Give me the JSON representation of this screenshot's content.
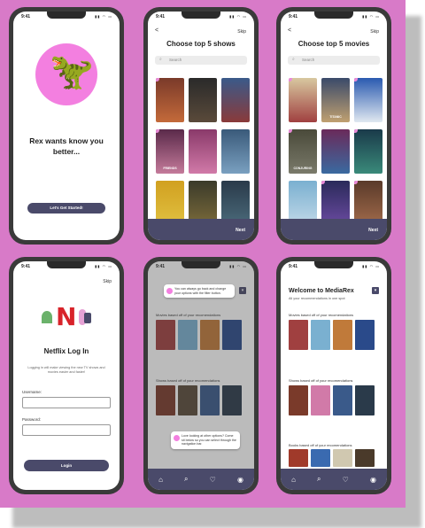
{
  "status": {
    "time": "9:41",
    "icons": "▮▮ ◠ ▭"
  },
  "common": {
    "skip": "Skip",
    "back": "<",
    "next": "Next"
  },
  "welcome": {
    "headline": "Rex wants know you better...",
    "cta": "Let's Get Started!"
  },
  "shows": {
    "title": "Choose top 5 shows",
    "search_placeholder": "Search",
    "posters": [
      "",
      "",
      "",
      "FRIENDS",
      "",
      "",
      "",
      "",
      ""
    ]
  },
  "movies": {
    "title": "Choose top 5 movies",
    "search_placeholder": "Search",
    "posters": [
      "",
      "TITANIC",
      "",
      "CONJURING",
      "",
      "",
      "",
      "",
      ""
    ]
  },
  "netflix": {
    "logo_letter": "N",
    "title": "Netflix Log In",
    "subtitle": "Logging in will make viewing the new TV shows and movies easier and faster!",
    "username_label": "Username:",
    "password_label": "Password:",
    "login_button": "Login"
  },
  "onboarding": {
    "tip_filter": "You can always go back and change your options with the filter button.",
    "tip_nav": "Love looking at other options? Come sit below so you can select through the navigation bar."
  },
  "home": {
    "title": "Welcome to MediaRex",
    "subtitle": "All your recommendations in one spot",
    "section_movies": "Movies based off of your recomendations",
    "section_shows": "Shows based off of your recomendations",
    "section_books": "Books based off of your recomendations"
  },
  "nav_icons": [
    "home-icon",
    "search-icon",
    "heart-icon",
    "profile-icon"
  ],
  "colors": {
    "accent": "#f37fe0",
    "bar": "#4a4a6a",
    "board": "#d87ac8"
  }
}
